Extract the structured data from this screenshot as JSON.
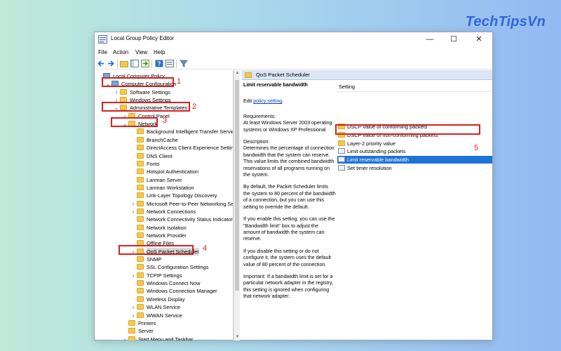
{
  "brand": "TechTipsVn",
  "window": {
    "title": "Local Group Policy Editor",
    "controls": {
      "minimize": "—",
      "maximize": "☐",
      "close": "✕"
    }
  },
  "menu": [
    "File",
    "Action",
    "View",
    "Help"
  ],
  "tree": [
    {
      "label": "Local Computer Policy",
      "icon": "computer-icon",
      "chevron": "",
      "indent": 0
    },
    {
      "label": "Computer Configuration",
      "icon": "computer-icon",
      "chevron": "v",
      "indent": 1
    },
    {
      "label": "Software Settings",
      "icon": "folder-icon",
      "chevron": ">",
      "indent": 2
    },
    {
      "label": "Windows Settings",
      "icon": "folder-icon",
      "chevron": ">",
      "indent": 2
    },
    {
      "label": "Administrative Templates",
      "icon": "folder-icon",
      "chevron": "v",
      "indent": 2
    },
    {
      "label": "Control Panel",
      "icon": "folder-icon",
      "chevron": ">",
      "indent": 3
    },
    {
      "label": "Network",
      "icon": "folder-icon",
      "chevron": "v",
      "indent": 3
    },
    {
      "label": "Background Intelligent Transfer Service",
      "icon": "folder-icon",
      "chevron": "",
      "indent": 4
    },
    {
      "label": "BranchCache",
      "icon": "folder-icon",
      "chevron": "",
      "indent": 4
    },
    {
      "label": "DirectAccess Client Experience Settings",
      "icon": "folder-icon",
      "chevron": "",
      "indent": 4
    },
    {
      "label": "DNS Client",
      "icon": "folder-icon",
      "chevron": "",
      "indent": 4
    },
    {
      "label": "Fonts",
      "icon": "folder-icon",
      "chevron": "",
      "indent": 4
    },
    {
      "label": "Hotspot Authentication",
      "icon": "folder-icon",
      "chevron": "",
      "indent": 4
    },
    {
      "label": "Lanman Server",
      "icon": "folder-icon",
      "chevron": "",
      "indent": 4
    },
    {
      "label": "Lanman Workstation",
      "icon": "folder-icon",
      "chevron": "",
      "indent": 4
    },
    {
      "label": "Link-Layer Topology Discovery",
      "icon": "folder-icon",
      "chevron": "",
      "indent": 4
    },
    {
      "label": "Microsoft Peer-to-Peer Networking Services",
      "icon": "folder-icon",
      "chevron": ">",
      "indent": 4
    },
    {
      "label": "Network Connections",
      "icon": "folder-icon",
      "chevron": ">",
      "indent": 4
    },
    {
      "label": "Network Connectivity Status Indicator",
      "icon": "folder-icon",
      "chevron": "",
      "indent": 4
    },
    {
      "label": "Network Isolation",
      "icon": "folder-icon",
      "chevron": "",
      "indent": 4
    },
    {
      "label": "Network Provider",
      "icon": "folder-icon",
      "chevron": "",
      "indent": 4
    },
    {
      "label": "Offline Files",
      "icon": "folder-icon",
      "chevron": "",
      "indent": 4
    },
    {
      "label": "QoS Packet Scheduler",
      "icon": "folder-icon",
      "chevron": ">",
      "indent": 4,
      "selected": true
    },
    {
      "label": "SNMP",
      "icon": "folder-icon",
      "chevron": "",
      "indent": 4
    },
    {
      "label": "SSL Configuration Settings",
      "icon": "folder-icon",
      "chevron": "",
      "indent": 4
    },
    {
      "label": "TCPIP Settings",
      "icon": "folder-icon",
      "chevron": ">",
      "indent": 4
    },
    {
      "label": "Windows Connect Now",
      "icon": "folder-icon",
      "chevron": "",
      "indent": 4
    },
    {
      "label": "Windows Connection Manager",
      "icon": "folder-icon",
      "chevron": "",
      "indent": 4
    },
    {
      "label": "Wireless Display",
      "icon": "folder-icon",
      "chevron": "",
      "indent": 4
    },
    {
      "label": "WLAN Service",
      "icon": "folder-icon",
      "chevron": ">",
      "indent": 4
    },
    {
      "label": "WWAN Service",
      "icon": "folder-icon",
      "chevron": ">",
      "indent": 4
    },
    {
      "label": "Printers",
      "icon": "folder-icon",
      "chevron": "",
      "indent": 3
    },
    {
      "label": "Server",
      "icon": "folder-icon",
      "chevron": "",
      "indent": 3
    },
    {
      "label": "Start Menu and Taskbar",
      "icon": "folder-icon",
      "chevron": ">",
      "indent": 3
    }
  ],
  "right_pane": {
    "header": "QoS Packet Scheduler",
    "policy_title": "Limit reservable bandwidth",
    "edit_prefix": "Edit ",
    "edit_link": "policy setting",
    "edit_suffix": ".",
    "paragraphs": [
      "Requirements:\nAt least Windows Server 2003 operating systems or Windows XP Professional",
      "Description:\nDetermines the percentage of connection bandwidth that the system can reserve. This value limits the combined bandwidth reservations of all programs running on the system.",
      "By default, the Packet Scheduler limits the system to 80 percent of the bandwidth of a connection, but you can use this setting to override the default.",
      "If you enable this setting, you can use the \"Bandwidth limit\" box to adjust the amount of bandwidth the system can reserve.",
      "If you disable this setting or do not configure it, the system uses the default value of 80 percent of the connection.",
      "Important: If a bandwidth limit is set for a particular network adapter in the registry, this setting is ignored when configuring that network adapter."
    ],
    "settings_header": "Setting",
    "settings": [
      {
        "label": "DSCP value of conforming packets",
        "icon": "folder-icon"
      },
      {
        "label": "DSCP value of non-conforming packets",
        "icon": "folder-icon"
      },
      {
        "label": "Layer-2 priority value",
        "icon": "folder-icon"
      },
      {
        "label": "Limit outstanding packets",
        "icon": "policy-icon"
      },
      {
        "label": "Limit reservable bandwidth",
        "icon": "policy-icon",
        "selected": true
      },
      {
        "label": "Set timer resolution",
        "icon": "policy-icon"
      }
    ]
  },
  "annotations": [
    "1",
    "2",
    "3",
    "4",
    "5"
  ],
  "colors": {
    "annotation": "#d92020",
    "selection": "#1f73d7",
    "brand": "#2f68d8"
  }
}
